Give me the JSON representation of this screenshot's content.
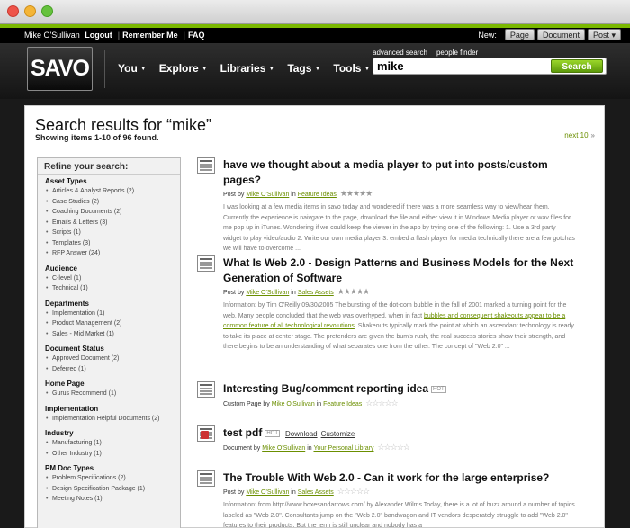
{
  "topbar": {
    "user": "Mike O'Sullivan",
    "logout": "Logout",
    "remember": "Remember Me",
    "faq": "FAQ",
    "new_label": "New:",
    "btn_page": "Page",
    "btn_document": "Document",
    "btn_post": "Post ▾"
  },
  "nav": {
    "logo": "SAVO",
    "menu": [
      "You",
      "Explore",
      "Libraries",
      "Tags",
      "Tools"
    ],
    "advanced_search": "advanced search",
    "people_finder": "people finder",
    "search_value": "mike",
    "search_button": "Search"
  },
  "results_header": {
    "title": "Search results for “mike”",
    "showing": "Showing items 1-10 of 96 found.",
    "next": "next 10"
  },
  "refine": {
    "title": "Refine your search:",
    "groups": [
      {
        "name": "Asset Types",
        "items": [
          "Articles & Analyst Reports (2)",
          "Case Studies (2)",
          "Coaching Documents (2)",
          "Emails & Letters (3)",
          "Scripts (1)",
          "Templates (3)",
          "RFP Answer (24)"
        ]
      },
      {
        "name": "Audience",
        "items": [
          "C-level (1)",
          "Technical (1)"
        ]
      },
      {
        "name": "Departments",
        "items": [
          "Implementation (1)",
          "Product Management (2)",
          "Sales - Mid Market (1)"
        ]
      },
      {
        "name": "Document Status",
        "items": [
          "Approved Document (2)",
          "Deferred (1)"
        ]
      },
      {
        "name": "Home Page",
        "items": [
          "Gurus Recommend (1)"
        ]
      },
      {
        "name": "Implementation",
        "items": [
          "Implementation Helpful Documents (2)"
        ]
      },
      {
        "name": "Industry",
        "items": [
          "Manufacturing (1)",
          "Other Industry (1)"
        ]
      },
      {
        "name": "PM Doc Types",
        "items": [
          "Problem Specifications (2)",
          "Design Specification Package (1)",
          "Meeting Notes (1)"
        ]
      }
    ]
  },
  "results": [
    {
      "title": "have we thought about a media player to put into posts/custom pages?",
      "type": "Post by",
      "author": "Mike O'Sullivan",
      "in": "in",
      "library": "Feature Ideas",
      "snippet_pre": "I was looking at a few media items in savo today and wondered if there was a more seamless way to view/hear them. Currently the experience is naivgate to the page, download the file and either view it in Windows Media player or wav files for me pop up in iTunes. Wondering if we could keep the viewer in the app by trying one of the following: 1. Use a 3rd party widget to play video/audio 2. Write our own media player 3. embed a flash player for media technically there are a few gotchas we will have to overcome ...",
      "snippet_hl": "",
      "snippet_post": ""
    },
    {
      "title": "What Is Web 2.0 - Design Patterns and Business Models for the Next Generation of Software",
      "type": "Post by",
      "author": "Mike O'Sullivan",
      "in": "in",
      "library": "Sales Assets",
      "snippet_pre": "Information: by Tim O'Reilly 09/30/2005 The bursting of the dot-com bubble in the fall of 2001 marked a turning point for the web. Many people concluded that the web was overhyped, when in fact ",
      "snippet_hl": "bubbles and consequent shakeouts appear to be a common feature of all technological revolutions",
      "snippet_post": ". Shakeouts typically mark the point at which an ascendant technology is ready to take its place at center stage. The pretenders are given the bum's rush, the real success stories show their strength, and there begins to be an understanding of what separates one from the other. The concept of \"Web 2.0\" ..."
    },
    {
      "title": "Interesting Bug/comment reporting idea",
      "badge": "HOT",
      "type": "Custom Page by",
      "author": "Mike O'Sullivan",
      "in": "in",
      "library": "Feature Ideas"
    },
    {
      "title": "test pdf",
      "badge": "HOT",
      "download": "Download",
      "customize": "Customize",
      "type": "Document by",
      "author": "Mike O'Sullivan",
      "in": "in",
      "library": "Your Personal Library"
    },
    {
      "title": "The Trouble With Web 2.0 - Can it work for the large enterprise?",
      "type": "Post by",
      "author": "Mike O'Sullivan",
      "in": "in",
      "library": "Sales Assets",
      "snippet_pre": "Information: from http://www.boxesandarrows.com/ by Alexander Wilms Today, there is a lot of buzz around a number of topics labeled as \"Web 2.0\". Consultants jump on the \"Web 2.0\" bandwagon and IT vendors desperately struggle to add \"Web 2.0\" features to their products. But the term is still unclear and nobody has a",
      "snippet_hl": "",
      "snippet_post": ""
    }
  ]
}
